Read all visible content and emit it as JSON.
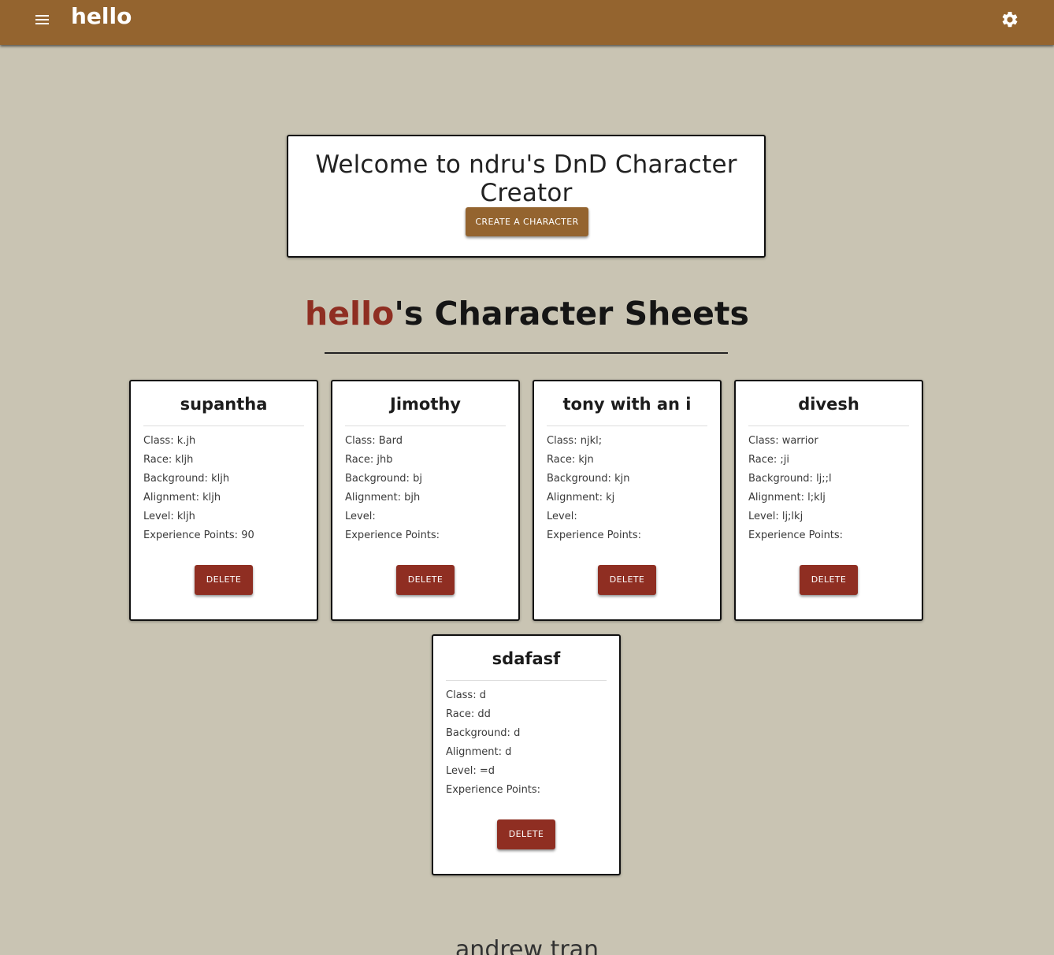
{
  "topbar": {
    "title": "hello",
    "menu_icon": "hamburger-menu-icon",
    "settings_icon": "gear-icon",
    "background_color": "#94642f"
  },
  "welcome": {
    "title": "Welcome to ndru's DnD Character Creator",
    "create_button_label": "CREATE A CHARACTER"
  },
  "sheets": {
    "username": "hello",
    "heading_suffix": "'s Character Sheets",
    "username_color": "#8f2e22"
  },
  "characters": [
    {
      "name": "supantha",
      "class": "Class: k.jh",
      "race": "Race: kljh",
      "background": "Background: kljh",
      "alignment": "Alignment: kljh",
      "level": "Level: kljh",
      "xp": "Experience Points: 90",
      "delete_label": "DELETE"
    },
    {
      "name": "Jimothy",
      "class": "Class: Bard",
      "race": "Race: jhb",
      "background": "Background: bj",
      "alignment": "Alignment: bjh",
      "level": "Level:",
      "xp": "Experience Points:",
      "delete_label": "DELETE"
    },
    {
      "name": "tony with an i",
      "class": "Class: njkl;",
      "race": "Race: kjn",
      "background": "Background: kjn",
      "alignment": "Alignment: kj",
      "level": "Level:",
      "xp": "Experience Points:",
      "delete_label": "DELETE"
    },
    {
      "name": "divesh",
      "class": "Class: warrior",
      "race": "Race: ;ji",
      "background": "Background: lj;;l",
      "alignment": "Alignment: l;klj",
      "level": "Level: lj;lkj",
      "xp": "Experience Points:",
      "delete_label": "DELETE"
    },
    {
      "name": "sdafasf",
      "class": "Class: d",
      "race": "Race: dd",
      "background": "Background: d",
      "alignment": "Alignment: d",
      "level": "Level: =d",
      "xp": "Experience Points:",
      "delete_label": "DELETE"
    }
  ],
  "footer": {
    "author": "andrew tran"
  },
  "colors": {
    "page_background": "#c9c4b3",
    "delete_button": "#8f2e22",
    "primary_button": "#94642f"
  }
}
